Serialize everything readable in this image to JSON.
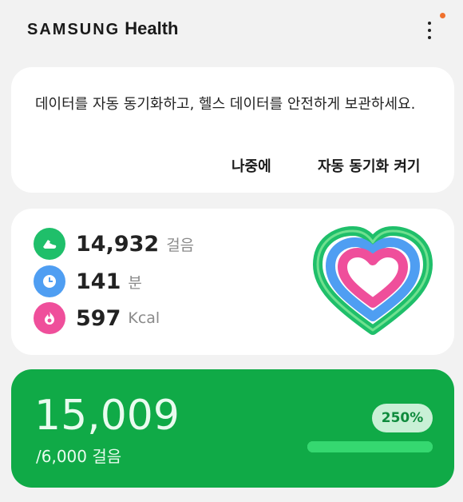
{
  "header": {
    "brand_samsung": "SAMSUNG",
    "brand_health": "Health",
    "notification_color": "#f0712d"
  },
  "sync_card": {
    "message": "데이터를 자동 동기화하고, 헬스 데이터를 안전하게 보관하세요.",
    "later_label": "나중에",
    "enable_label": "자동 동기화 켜기"
  },
  "activity": {
    "steps": {
      "value": "14,932",
      "unit": "걸음",
      "icon": "shoe-icon"
    },
    "minutes": {
      "value": "141",
      "unit": "분",
      "icon": "clock-icon"
    },
    "calories": {
      "value": "597",
      "unit": "Kcal",
      "icon": "flame-icon"
    },
    "colors": {
      "steps": "#1fbf6a",
      "minutes": "#4f9ef2",
      "calories": "#ef4f9b"
    }
  },
  "goal": {
    "steps": "15,009",
    "target": "/6,000 걸음",
    "percent": "250%",
    "progress_fraction": 1.0,
    "accent": "#10aa47"
  }
}
